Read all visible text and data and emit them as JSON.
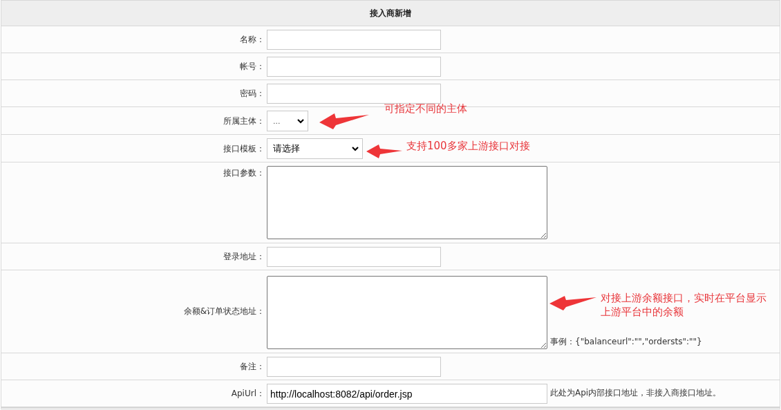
{
  "title": "接入商新增",
  "rows": [
    {
      "label": "名称：",
      "kind": "input"
    },
    {
      "label": "帐号：",
      "kind": "input"
    },
    {
      "label": "密码：",
      "kind": "input"
    },
    {
      "label": "所属主体：",
      "kind": "short-select",
      "value": "..."
    },
    {
      "label": "接口模板：",
      "kind": "select",
      "value": "请选择"
    },
    {
      "label": "接口参数：",
      "kind": "textarea"
    },
    {
      "label": "登录地址：",
      "kind": "input"
    },
    {
      "label": "余额&订单状态地址：",
      "kind": "textarea",
      "note": "事例：{\"balanceurl\":\"\",\"ordersts\":\"\"}"
    },
    {
      "label": "备注：",
      "kind": "input"
    },
    {
      "label": "ApiUrl：",
      "kind": "long-input",
      "value": "http://localhost:8082/api/order.jsp",
      "note": "此处为Api内部接口地址，非接入商接口地址。"
    }
  ],
  "annotations": [
    {
      "text": "可指定不同的主体"
    },
    {
      "text": "支持100多家上游接口对接"
    },
    {
      "text": "对接上游余额接口，实时在平台显示上游平台中的余额"
    }
  ]
}
